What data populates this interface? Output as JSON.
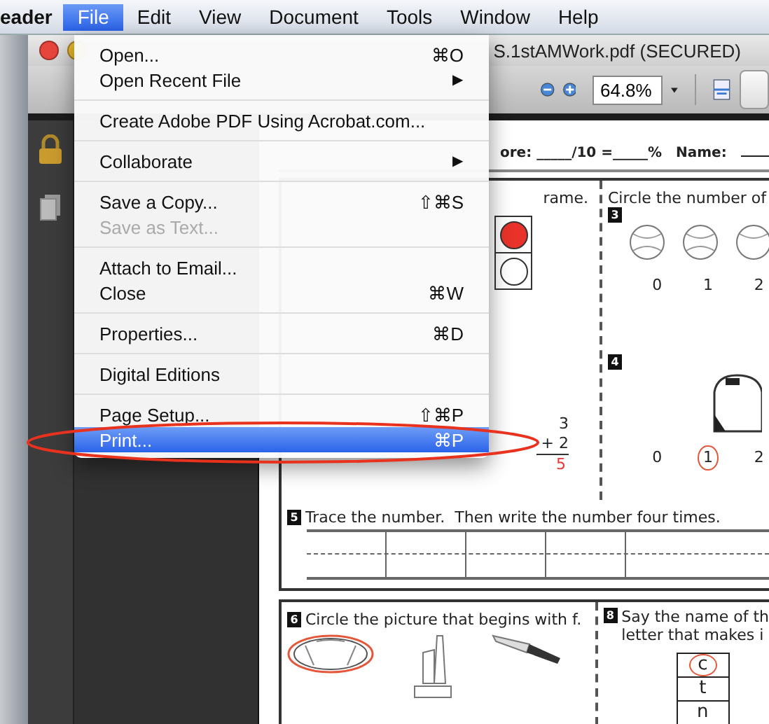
{
  "menu_bar": {
    "app_name": "eader",
    "items": [
      {
        "label": "File",
        "selected": true
      },
      {
        "label": "Edit",
        "selected": false
      },
      {
        "label": "View",
        "selected": false
      },
      {
        "label": "Document",
        "selected": false
      },
      {
        "label": "Tools",
        "selected": false
      },
      {
        "label": "Window",
        "selected": false
      },
      {
        "label": "Help",
        "selected": false
      }
    ]
  },
  "file_menu": {
    "sections": [
      [
        {
          "label": "Open...",
          "shortcut": "⌘O",
          "disabled": false,
          "selected": false
        },
        {
          "label": "Open Recent File",
          "submenu_arrow": "▶",
          "disabled": false,
          "selected": false
        }
      ],
      [
        {
          "label": "Create Adobe PDF Using Acrobat.com...",
          "disabled": false,
          "selected": false
        }
      ],
      [
        {
          "label": "Collaborate",
          "submenu_arrow": "▶",
          "disabled": false,
          "selected": false
        }
      ],
      [
        {
          "label": "Save a Copy...",
          "shortcut": "⇧⌘S",
          "disabled": false,
          "selected": false
        },
        {
          "label": "Save as Text...",
          "disabled": true,
          "selected": false
        }
      ],
      [
        {
          "label": "Attach to Email...",
          "disabled": false,
          "selected": false
        },
        {
          "label": "Close",
          "shortcut": "⌘W",
          "disabled": false,
          "selected": false
        }
      ],
      [
        {
          "label": "Properties...",
          "shortcut": "⌘D",
          "disabled": false,
          "selected": false
        }
      ],
      [
        {
          "label": "Digital Editions",
          "disabled": false,
          "selected": false
        }
      ],
      [
        {
          "label": "Page Setup...",
          "shortcut": "⇧⌘P",
          "disabled": false,
          "selected": false
        },
        {
          "label": "Print...",
          "shortcut": "⌘P",
          "disabled": false,
          "selected": true
        }
      ]
    ]
  },
  "window": {
    "title": "S.1stAMWork.pdf (SECURED)",
    "zoom_field": {
      "value": "64.8%"
    }
  },
  "document": {
    "score": "ore: _____/10 =_____%",
    "name_label": "Name:",
    "section_1": {
      "instruction": "rame.",
      "frame": [
        {
          "filled": true
        },
        {
          "filled": false
        }
      ]
    },
    "section_2": {
      "addend_1": "3",
      "addend_2": "+ 2",
      "answer": "5"
    },
    "section_3": {
      "instruction": "Circle the number of",
      "badge": "3",
      "choices": [
        {
          "label": "0",
          "selected": false
        },
        {
          "label": "1",
          "selected": false
        },
        {
          "label": "2",
          "selected": false
        }
      ]
    },
    "section_4": {
      "badge": "4",
      "choices": [
        {
          "label": "0",
          "selected": false
        },
        {
          "label": "1",
          "selected": true
        },
        {
          "label": "2",
          "selected": false
        }
      ]
    },
    "section_5": {
      "badge": "5",
      "instruction": "Trace the number.  Then write the number four times."
    },
    "section_6": {
      "badge": "6",
      "instruction": "Circle the picture that begins with f.",
      "pictures": [
        {
          "kind": "football",
          "selected": true
        },
        {
          "kind": "vacuum",
          "selected": false
        },
        {
          "kind": "knife",
          "selected": false
        }
      ]
    },
    "section_8": {
      "badge": "8",
      "instruction_lines": [
        "Say the name of th",
        "letter that makes i"
      ],
      "letters": [
        {
          "label": "c",
          "selected": true
        },
        {
          "label": "t",
          "selected": false
        },
        {
          "label": "n",
          "selected": false
        }
      ]
    }
  }
}
